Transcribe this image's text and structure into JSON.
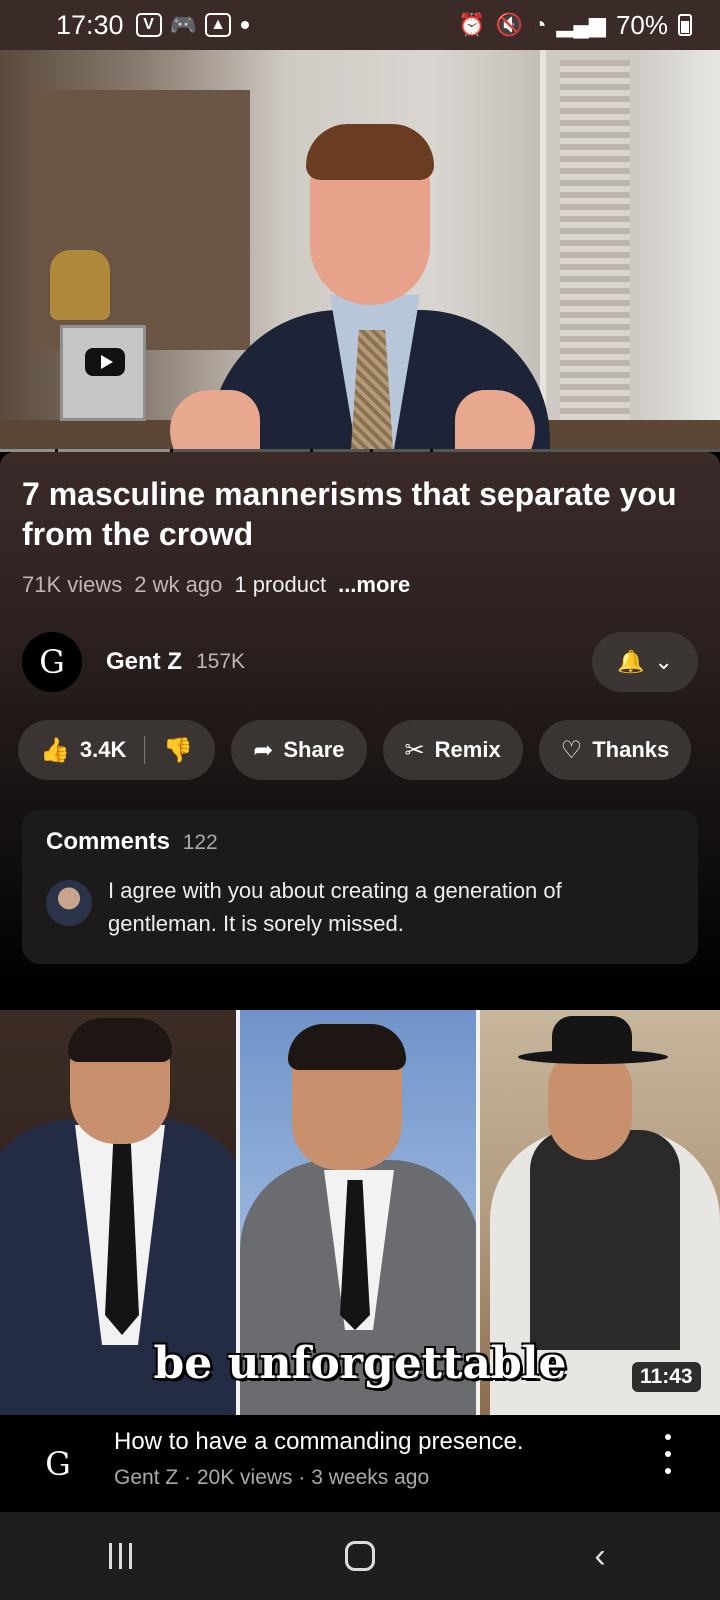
{
  "status_bar": {
    "time": "17:30",
    "battery": "70%",
    "left_icons": [
      "v-icon",
      "gamepad-icon",
      "image-icon"
    ],
    "right_icons": [
      "alarm-icon",
      "mute-icon",
      "wifi-icon",
      "signal-icon",
      "signal-icon"
    ]
  },
  "video": {
    "title": "7 masculine mannerisms that separate you from the crowd",
    "views": "71K views",
    "age": "2 wk ago",
    "product": "1 product",
    "more": "...more"
  },
  "channel": {
    "avatar_letter": "G",
    "name": "Gent Z",
    "subscribers": "157K"
  },
  "actions": {
    "likes": "3.4K",
    "share": "Share",
    "remix": "Remix",
    "thanks": "Thanks"
  },
  "comments": {
    "label": "Comments",
    "count": "122",
    "top_comment": "I agree with you about creating a generation of gentleman. It is sorely missed."
  },
  "next_video": {
    "thumbnail_caption": "be unforgettable",
    "duration": "11:43",
    "title": "How to have a commanding presence.",
    "subtitle": "Gent Z · 20K views · 3 weeks ago",
    "avatar_letter": "G"
  },
  "colors": {
    "panel_top": "#3a2b29",
    "pill_bg": "#3a3432",
    "status_bar_bg": "#3a2a28"
  }
}
